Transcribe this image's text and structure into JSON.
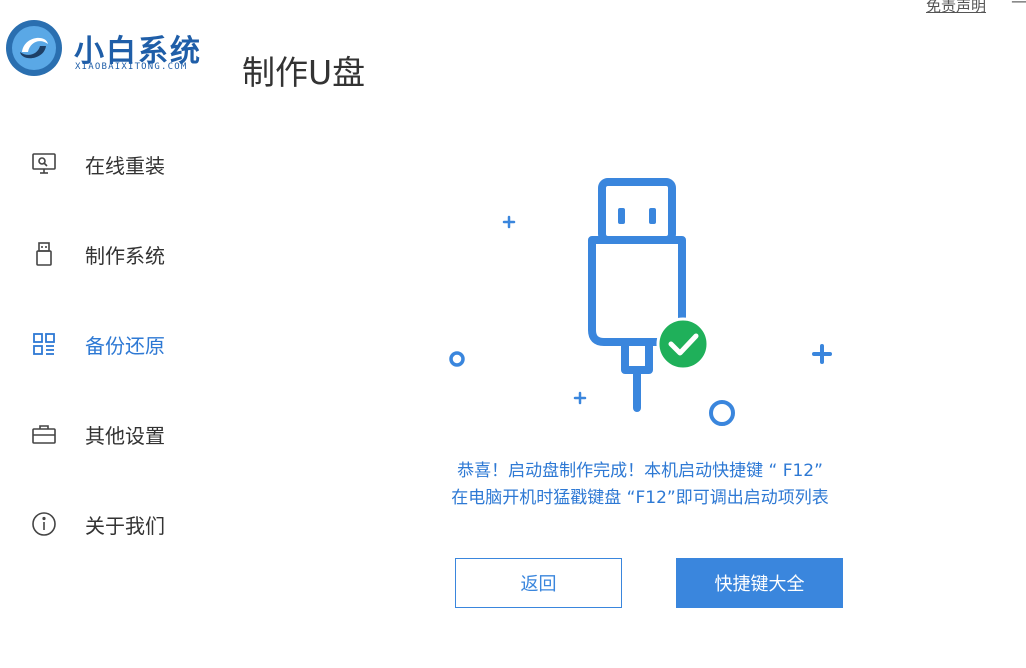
{
  "header": {
    "logo_name": "小白系统",
    "logo_sub": "XIAOBAIXITONG.COM",
    "page_title": "制作U盘",
    "disclaimer": "免责声明",
    "minimize": "—"
  },
  "sidebar": {
    "items": [
      {
        "label": "在线重装",
        "icon": "monitor-icon",
        "active": false
      },
      {
        "label": "制作系统",
        "icon": "usb-drive-icon",
        "active": false
      },
      {
        "label": "备份还原",
        "icon": "grid-icon",
        "active": true
      },
      {
        "label": "其他设置",
        "icon": "briefcase-icon",
        "active": false
      },
      {
        "label": "关于我们",
        "icon": "info-icon",
        "active": false
      }
    ]
  },
  "main": {
    "message_line1": "恭喜！启动盘制作完成！本机启动快捷键 “ F12”",
    "message_line2": "在电脑开机时猛戳键盘 “F12”即可调出启动项列表",
    "back_button": "返回",
    "hotkeys_button": "快捷键大全"
  },
  "colors": {
    "accent": "#3a86dd",
    "brand": "#1f5ea8",
    "success": "#1fb05a"
  }
}
